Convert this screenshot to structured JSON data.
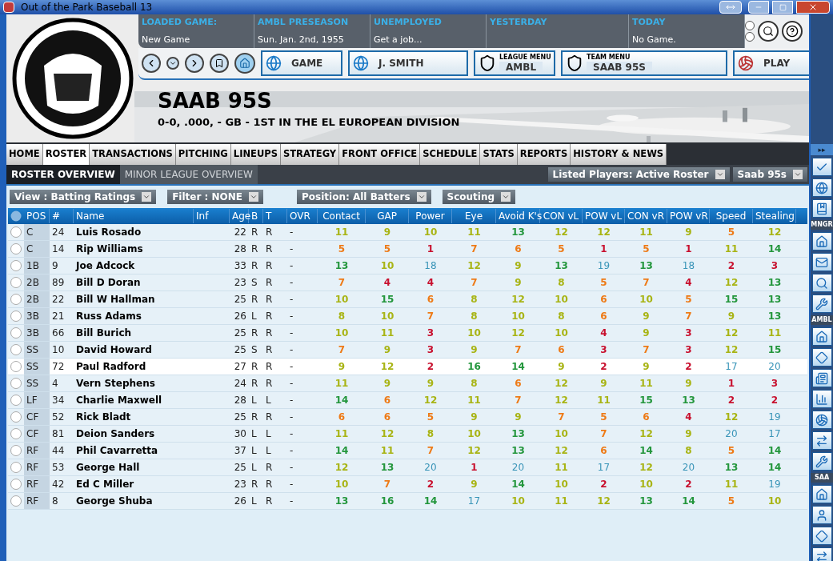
{
  "window": {
    "title": "Out of the Park Baseball 13"
  },
  "info_bar": [
    {
      "label": "LOADED GAME:",
      "value": "New Game"
    },
    {
      "label": "AMBL PRESEASON",
      "value": "Sun. Jan. 2nd, 1955"
    },
    {
      "label": "UNEMPLOYED",
      "value": "Get a job..."
    },
    {
      "label": "YESTERDAY"
    },
    {
      "label": "TODAY",
      "value": "No Game."
    }
  ],
  "toolbar": [
    {
      "kind": "main",
      "label": "GAME"
    },
    {
      "kind": "main",
      "label": "J. SMITH"
    },
    {
      "kind": "menu",
      "caption": "LEAGUE MENU",
      "label": "AMBL"
    },
    {
      "kind": "menu",
      "caption": "TEAM MENU",
      "label": "SAAB 95S"
    },
    {
      "kind": "main",
      "label": "PLAY"
    }
  ],
  "team": {
    "name": "SAAB 95S",
    "record": "0-0, .000, - GB - 1ST IN THE EL EUROPEAN DIVISION"
  },
  "tabs": [
    {
      "label": "HOME",
      "selected": false
    },
    {
      "label": "ROSTER",
      "selected": true
    },
    {
      "label": "TRANSACTIONS",
      "selected": false
    },
    {
      "label": "PITCHING",
      "selected": false
    },
    {
      "label": "LINEUPS",
      "selected": false
    },
    {
      "label": "STRATEGY",
      "selected": false
    },
    {
      "label": "FRONT OFFICE",
      "selected": false
    },
    {
      "label": "SCHEDULE",
      "selected": false
    },
    {
      "label": "STATS",
      "selected": false
    },
    {
      "label": "REPORTS",
      "selected": false
    },
    {
      "label": "HISTORY & NEWS",
      "selected": false
    }
  ],
  "subtabs": [
    {
      "label": "ROSTER OVERVIEW",
      "selected": true
    },
    {
      "label": "MINOR LEAGUE OVERVIEW",
      "selected": false
    }
  ],
  "right_dropdowns": [
    "Listed Players: Active Roster",
    "Saab 95s"
  ],
  "filters": [
    "View : Batting Ratings",
    "Filter : NONE",
    "Position: All Batters",
    "Scouting"
  ],
  "table": {
    "columns": [
      "POS",
      "#",
      "Name",
      "Inf",
      "Age",
      "B",
      "T",
      "OVR",
      "Contact",
      "GAP",
      "Power",
      "Eye",
      "Avoid K's",
      "CON vL",
      "POW vL",
      "CON vR",
      "POW vR",
      "Speed",
      "Stealing"
    ],
    "rows": [
      {
        "selected": false,
        "cells": [
          "C",
          "24",
          "Luis Rosado",
          "",
          "22",
          "R",
          "R",
          "-",
          "11",
          "9",
          "10",
          "11",
          "13",
          "12",
          "12",
          "11",
          "9",
          "5",
          "12"
        ]
      },
      {
        "selected": false,
        "cells": [
          "C",
          "14",
          "Rip Williams",
          "",
          "28",
          "R",
          "R",
          "-",
          "5",
          "5",
          "1",
          "7",
          "6",
          "5",
          "1",
          "5",
          "1",
          "11",
          "14"
        ]
      },
      {
        "selected": false,
        "cells": [
          "1B",
          "9",
          "Joe Adcock",
          "",
          "33",
          "R",
          "R",
          "-",
          "13",
          "10",
          "18",
          "12",
          "9",
          "13",
          "19",
          "13",
          "18",
          "2",
          "3"
        ]
      },
      {
        "selected": false,
        "cells": [
          "2B",
          "89",
          "Bill D Doran",
          "",
          "23",
          "S",
          "R",
          "-",
          "7",
          "4",
          "4",
          "7",
          "9",
          "8",
          "5",
          "7",
          "4",
          "12",
          "13"
        ]
      },
      {
        "selected": false,
        "cells": [
          "2B",
          "22",
          "Bill W Hallman",
          "",
          "25",
          "R",
          "R",
          "-",
          "10",
          "15",
          "6",
          "8",
          "12",
          "10",
          "6",
          "10",
          "5",
          "15",
          "13"
        ]
      },
      {
        "selected": false,
        "cells": [
          "3B",
          "21",
          "Russ Adams",
          "",
          "26",
          "L",
          "R",
          "-",
          "8",
          "10",
          "7",
          "8",
          "10",
          "8",
          "6",
          "9",
          "7",
          "9",
          "13"
        ]
      },
      {
        "selected": false,
        "cells": [
          "3B",
          "66",
          "Bill Burich",
          "",
          "25",
          "R",
          "R",
          "-",
          "10",
          "11",
          "3",
          "10",
          "12",
          "10",
          "4",
          "9",
          "3",
          "12",
          "11"
        ]
      },
      {
        "selected": false,
        "cells": [
          "SS",
          "10",
          "David Howard",
          "",
          "25",
          "S",
          "R",
          "-",
          "7",
          "9",
          "3",
          "9",
          "7",
          "6",
          "3",
          "7",
          "3",
          "12",
          "15"
        ]
      },
      {
        "selected": true,
        "cells": [
          "SS",
          "72",
          "Paul Radford",
          "",
          "27",
          "R",
          "R",
          "-",
          "9",
          "12",
          "2",
          "16",
          "14",
          "9",
          "2",
          "9",
          "2",
          "17",
          "20"
        ]
      },
      {
        "selected": false,
        "cells": [
          "SS",
          "4",
          "Vern Stephens",
          "",
          "24",
          "R",
          "R",
          "-",
          "11",
          "9",
          "9",
          "8",
          "6",
          "12",
          "9",
          "11",
          "9",
          "1",
          "3"
        ]
      },
      {
        "selected": false,
        "cells": [
          "LF",
          "34",
          "Charlie Maxwell",
          "",
          "28",
          "L",
          "L",
          "-",
          "14",
          "6",
          "12",
          "11",
          "7",
          "12",
          "11",
          "15",
          "13",
          "2",
          "2"
        ]
      },
      {
        "selected": false,
        "cells": [
          "CF",
          "52",
          "Rick Bladt",
          "",
          "25",
          "R",
          "R",
          "-",
          "6",
          "6",
          "5",
          "9",
          "9",
          "7",
          "5",
          "6",
          "4",
          "12",
          "19"
        ]
      },
      {
        "selected": false,
        "cells": [
          "CF",
          "81",
          "Deion Sanders",
          "",
          "30",
          "L",
          "L",
          "-",
          "11",
          "12",
          "8",
          "10",
          "13",
          "10",
          "7",
          "12",
          "9",
          "20",
          "17"
        ]
      },
      {
        "selected": false,
        "cells": [
          "RF",
          "44",
          "Phil Cavarretta",
          "",
          "37",
          "L",
          "L",
          "-",
          "14",
          "11",
          "7",
          "12",
          "13",
          "12",
          "6",
          "14",
          "8",
          "5",
          "14"
        ]
      },
      {
        "selected": false,
        "cells": [
          "RF",
          "53",
          "George Hall",
          "",
          "25",
          "L",
          "R",
          "-",
          "12",
          "13",
          "20",
          "1",
          "20",
          "11",
          "17",
          "12",
          "20",
          "13",
          "14"
        ]
      },
      {
        "selected": false,
        "cells": [
          "RF",
          "42",
          "Ed C Miller",
          "",
          "23",
          "R",
          "R",
          "-",
          "10",
          "7",
          "2",
          "9",
          "14",
          "10",
          "2",
          "10",
          "2",
          "11",
          "19"
        ]
      },
      {
        "selected": false,
        "cells": [
          "RF",
          "8",
          "George Shuba",
          "",
          "26",
          "L",
          "R",
          "-",
          "13",
          "16",
          "14",
          "17",
          "10",
          "11",
          "12",
          "13",
          "14",
          "5",
          "10"
        ]
      }
    ]
  },
  "sidebar": {
    "top": "▸▸",
    "sections": [
      "MNGR",
      "AMBL",
      "SAA"
    ]
  }
}
